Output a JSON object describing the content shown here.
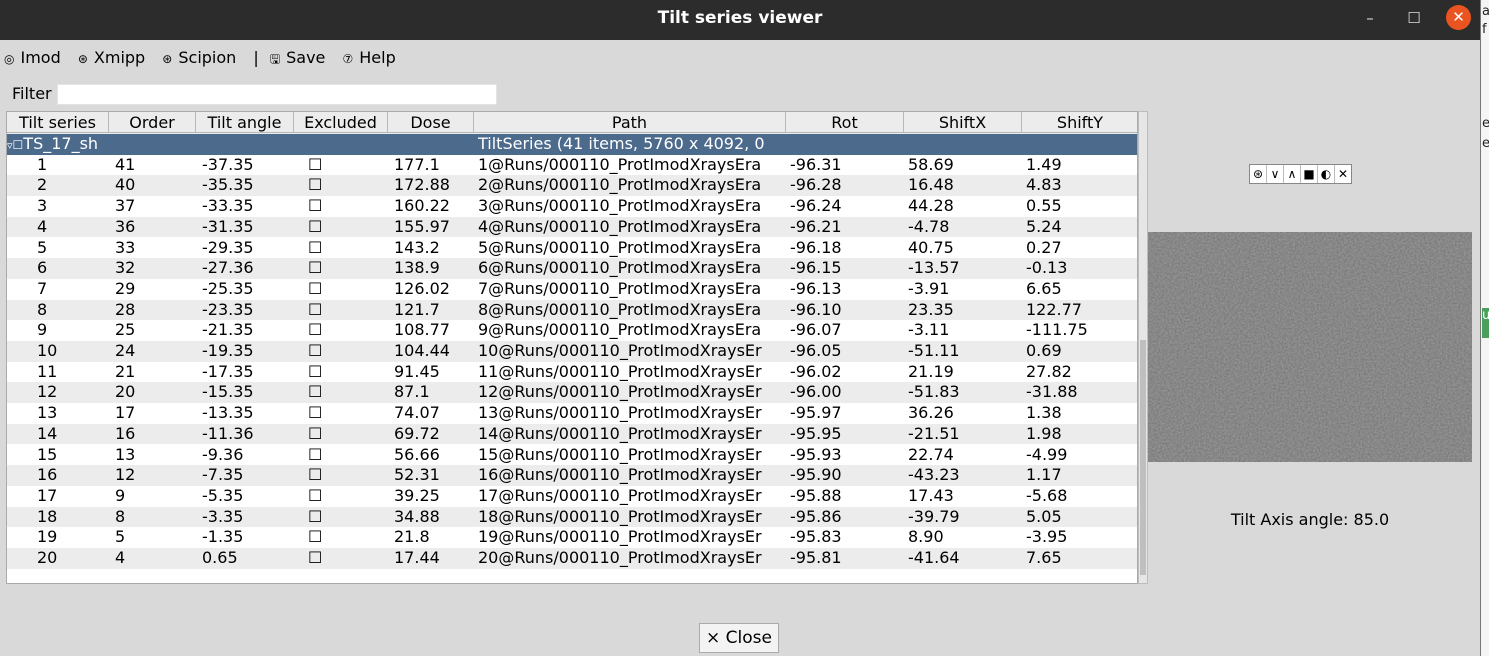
{
  "window": {
    "title": "Tilt series viewer",
    "min_glyph": "–",
    "max_glyph": "☐",
    "close_glyph": "✕"
  },
  "edge_fragments": [
    "a",
    "f",
    "es",
    "e",
    "u"
  ],
  "menu": [
    {
      "icon": "◎",
      "label": "Imod"
    },
    {
      "icon": "⊛",
      "label": "Xmipp"
    },
    {
      "icon": "⊛",
      "label": "Scipion"
    },
    {
      "icon": "",
      "label": "|"
    },
    {
      "icon": "🖫",
      "label": "Save"
    },
    {
      "icon": "⑦",
      "label": "Help"
    }
  ],
  "filter": {
    "label": "Filter",
    "value": ""
  },
  "table": {
    "columns": [
      "Tilt series",
      "Order",
      "Tilt angle",
      "Excluded",
      "Dose",
      "Path",
      "Rot",
      "ShiftX",
      "ShiftY"
    ],
    "group": {
      "expander": "▿",
      "checkbox": "☐",
      "name": "TS_17_sh",
      "path": "TiltSeries (41 items, 5760 x 4092, 0"
    },
    "rows": [
      [
        "1",
        "41",
        "-37.35",
        "☐",
        "177.1",
        "1@Runs/000110_ProtImodXraysEra",
        "-96.31",
        "58.69",
        "1.49"
      ],
      [
        "2",
        "40",
        "-35.35",
        "☐",
        "172.88",
        "2@Runs/000110_ProtImodXraysEra",
        "-96.28",
        "16.48",
        "4.83"
      ],
      [
        "3",
        "37",
        "-33.35",
        "☐",
        "160.22",
        "3@Runs/000110_ProtImodXraysEra",
        "-96.24",
        "44.28",
        "0.55"
      ],
      [
        "4",
        "36",
        "-31.35",
        "☐",
        "155.97",
        "4@Runs/000110_ProtImodXraysEra",
        "-96.21",
        "-4.78",
        "5.24"
      ],
      [
        "5",
        "33",
        "-29.35",
        "☐",
        "143.2",
        "5@Runs/000110_ProtImodXraysEra",
        "-96.18",
        "40.75",
        "0.27"
      ],
      [
        "6",
        "32",
        "-27.36",
        "☐",
        "138.9",
        "6@Runs/000110_ProtImodXraysEra",
        "-96.15",
        "-13.57",
        "-0.13"
      ],
      [
        "7",
        "29",
        "-25.35",
        "☐",
        "126.02",
        "7@Runs/000110_ProtImodXraysEra",
        "-96.13",
        "-3.91",
        "6.65"
      ],
      [
        "8",
        "28",
        "-23.35",
        "☐",
        "121.7",
        "8@Runs/000110_ProtImodXraysEra",
        "-96.10",
        "23.35",
        "122.77"
      ],
      [
        "9",
        "25",
        "-21.35",
        "☐",
        "108.77",
        "9@Runs/000110_ProtImodXraysEra",
        "-96.07",
        "-3.11",
        "-111.75"
      ],
      [
        "10",
        "24",
        "-19.35",
        "☐",
        "104.44",
        "10@Runs/000110_ProtImodXraysEr",
        "-96.05",
        "-51.11",
        "0.69"
      ],
      [
        "11",
        "21",
        "-17.35",
        "☐",
        "91.45",
        "11@Runs/000110_ProtImodXraysEr",
        "-96.02",
        "21.19",
        "27.82"
      ],
      [
        "12",
        "20",
        "-15.35",
        "☐",
        "87.1",
        "12@Runs/000110_ProtImodXraysEr",
        "-96.00",
        "-51.83",
        "-31.88"
      ],
      [
        "13",
        "17",
        "-13.35",
        "☐",
        "74.07",
        "13@Runs/000110_ProtImodXraysEr",
        "-95.97",
        "36.26",
        "1.38"
      ],
      [
        "14",
        "16",
        "-11.36",
        "☐",
        "69.72",
        "14@Runs/000110_ProtImodXraysEr",
        "-95.95",
        "-21.51",
        "1.98"
      ],
      [
        "15",
        "13",
        "-9.36",
        "☐",
        "56.66",
        "15@Runs/000110_ProtImodXraysEr",
        "-95.93",
        "22.74",
        "-4.99"
      ],
      [
        "16",
        "12",
        "-7.35",
        "☐",
        "52.31",
        "16@Runs/000110_ProtImodXraysEr",
        "-95.90",
        "-43.23",
        "1.17"
      ],
      [
        "17",
        "9",
        "-5.35",
        "☐",
        "39.25",
        "17@Runs/000110_ProtImodXraysEr",
        "-95.88",
        "17.43",
        "-5.68"
      ],
      [
        "18",
        "8",
        "-3.35",
        "☐",
        "34.88",
        "18@Runs/000110_ProtImodXraysEr",
        "-95.86",
        "-39.79",
        "5.05"
      ],
      [
        "19",
        "5",
        "-1.35",
        "☐",
        "21.8",
        "19@Runs/000110_ProtImodXraysEr",
        "-95.83",
        "8.90",
        "-3.95"
      ],
      [
        "20",
        "4",
        "0.65",
        "☐",
        "17.44",
        "20@Runs/000110_ProtImodXraysEr",
        "-95.81",
        "-41.64",
        "7.65"
      ]
    ]
  },
  "image_toolbar": [
    {
      "name": "home-icon",
      "glyph": "⊛"
    },
    {
      "name": "chevron-down-icon",
      "glyph": "∨"
    },
    {
      "name": "chevron-up-icon",
      "glyph": "∧"
    },
    {
      "name": "square-icon",
      "glyph": "■"
    },
    {
      "name": "contrast-icon",
      "glyph": "◐"
    },
    {
      "name": "close-icon",
      "glyph": "✕"
    }
  ],
  "tilt_axis_text": "Tilt Axis angle: 85.0",
  "close_button": {
    "icon": "×",
    "label": "Close"
  },
  "colors": {
    "titlebar": "#2c2c2c",
    "selected_row": "#4c6a8c",
    "close_accent": "#e95420"
  }
}
